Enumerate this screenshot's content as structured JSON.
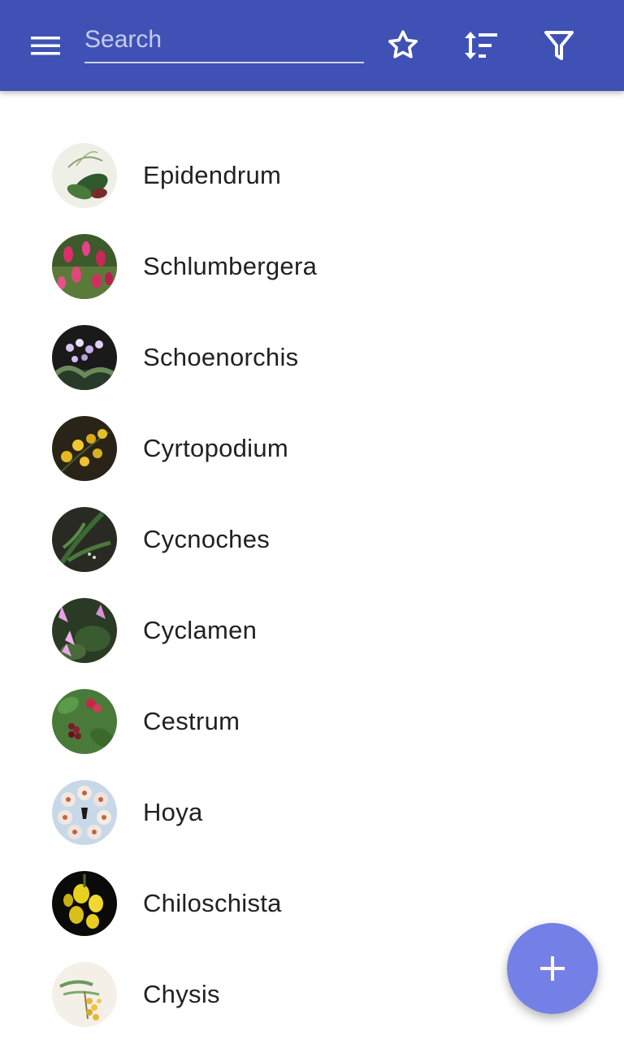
{
  "app_bar": {
    "background": "#3f51b5",
    "menu_icon": "hamburger-menu-icon",
    "search": {
      "placeholder": "Search",
      "value": ""
    },
    "actions": [
      {
        "name": "favorites",
        "icon": "star-outline-icon"
      },
      {
        "name": "sort",
        "icon": "sort-icon"
      },
      {
        "name": "filter",
        "icon": "filter-icon"
      }
    ]
  },
  "plants": [
    {
      "name": "Epidendrum",
      "thumb_icon": "white-orchid-thumbnail"
    },
    {
      "name": "Schlumbergera",
      "thumb_icon": "pink-cactus-flower-thumbnail"
    },
    {
      "name": "Schoenorchis",
      "thumb_icon": "lilac-orchid-thumbnail"
    },
    {
      "name": "Cyrtopodium",
      "thumb_icon": "yellow-orchid-thumbnail"
    },
    {
      "name": "Cycnoches",
      "thumb_icon": "green-leaves-thumbnail"
    },
    {
      "name": "Cyclamen",
      "thumb_icon": "pink-cyclamen-thumbnail"
    },
    {
      "name": "Cestrum",
      "thumb_icon": "red-berries-thumbnail"
    },
    {
      "name": "Hoya",
      "thumb_icon": "white-star-flowers-thumbnail"
    },
    {
      "name": "Chiloschista",
      "thumb_icon": "yellow-flowers-dark-thumbnail"
    },
    {
      "name": "Chysis",
      "thumb_icon": "yellow-orchid-illustration-thumbnail"
    }
  ],
  "fab": {
    "icon": "plus-icon",
    "color": "#7580e6"
  }
}
